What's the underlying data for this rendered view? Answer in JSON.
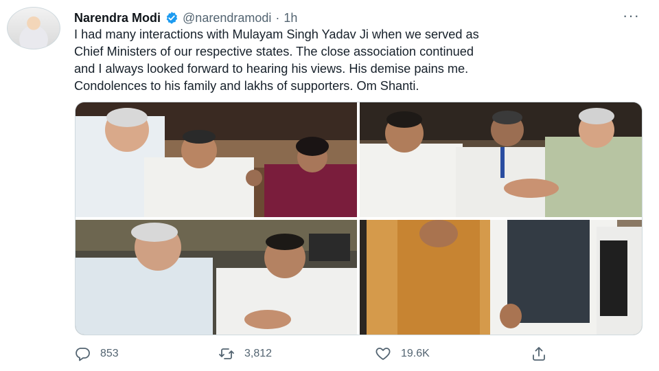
{
  "tweet": {
    "author_name": "Narendra Modi",
    "handle": "@narendramodi",
    "separator": "·",
    "time": "1h",
    "more": "···",
    "lines": [
      "I had many interactions with Mulayam Singh Yadav Ji when we served as",
      "Chief Ministers of our respective states. The close association continued",
      "and I always looked forward to hearing his views. His demise pains me.",
      "Condolences to his family and lakhs of supporters. Om Shanti."
    ]
  },
  "actions": {
    "replies": "853",
    "retweets": "3,812",
    "likes": "19.6K"
  },
  "colors": {
    "verified": "#1d9bf0",
    "secondary_text": "#536471"
  }
}
